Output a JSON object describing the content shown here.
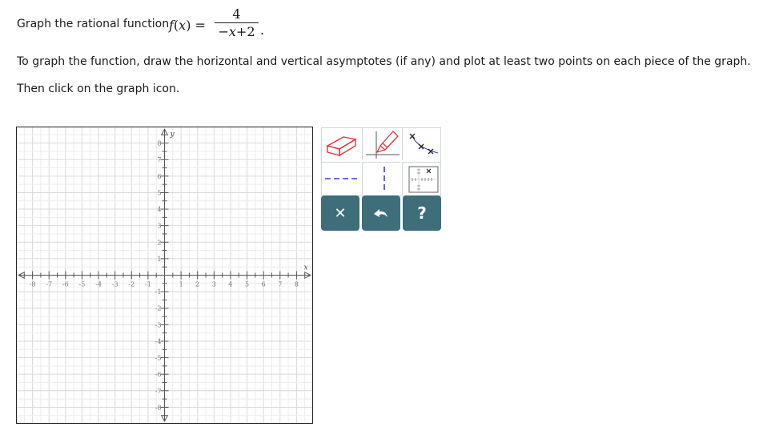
{
  "question": {
    "prefix": "Graph the rational function ",
    "f": "f",
    "x": "x",
    "eq": "=",
    "numerator": "4",
    "denominator_sign": "−",
    "denominator_var": "x",
    "denominator_rest": "+2",
    "period": ".",
    "instruction": "To graph the function, draw the horizontal and vertical asymptotes (if any) and plot at least two points on each piece of the graph.",
    "instruction2": "Then click on the graph icon."
  },
  "graph": {
    "x_axis_label": "x",
    "y_axis_label": "y",
    "x_ticks": [
      "-8",
      "-7",
      "-6",
      "-5",
      "-4",
      "-3",
      "-2",
      "-1",
      "1",
      "2",
      "3",
      "4",
      "5",
      "6",
      "7",
      "8"
    ],
    "y_ticks": [
      "8",
      "7",
      "6",
      "5",
      "4",
      "3",
      "2",
      "1",
      "-1",
      "-2",
      "-3",
      "-4",
      "-5",
      "-6",
      "-7",
      "-8"
    ],
    "xlim": [
      -9,
      9
    ],
    "ylim": [
      -9,
      9
    ],
    "grid": true
  },
  "tools": {
    "eraser": "eraser-tool",
    "line": "line-draw-tool",
    "points": "plot-points-tool",
    "h_asymptote": "horizontal-asymptote-tool",
    "v_asymptote": "vertical-asymptote-tool",
    "graph_icon": "graph-icon",
    "clear": "✕",
    "undo": "undo-icon",
    "help": "?"
  },
  "colors": {
    "accent": "#3d6e79",
    "eraser_red": "#e8333a",
    "asymptote_blue": "#3b3bd6"
  }
}
